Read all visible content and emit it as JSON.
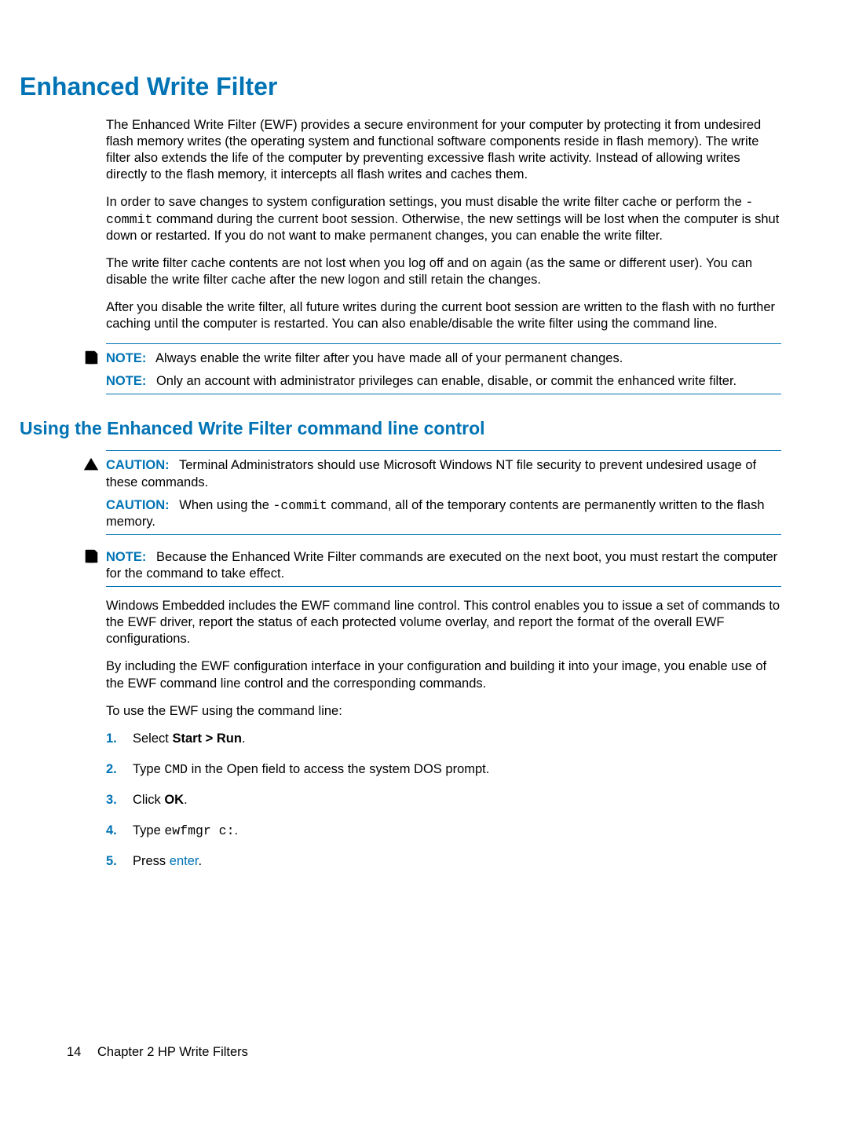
{
  "h1": "Enhanced Write Filter",
  "p1a": "The Enhanced Write Filter (EWF) provides a secure environment for your computer by protecting it from undesired flash memory writes (the operating system and functional software components reside in flash memory). The write filter also extends the life of the computer by preventing excessive flash write activity. Instead of allowing writes directly to the flash memory, it intercepts all flash writes and caches them.",
  "p2_pre": "In order to save changes to system configuration settings, you must disable the write filter cache or perform the ",
  "code_commit": "-commit",
  "p2_post": " command during the current boot session. Otherwise, the new settings will be lost when the computer is shut down or restarted. If you do not want to make permanent changes, you can enable the write filter.",
  "p3": "The write filter cache contents are not lost when you log off and on again (as the same or different user). You can disable the write filter cache after the new logon and still retain the changes.",
  "p4": "After you disable the write filter, all future writes during the current boot session are written to the flash with no further caching until the computer is restarted. You can also enable/disable the write filter using the command line.",
  "note_label": "NOTE:",
  "caution_label": "CAUTION:",
  "note1": "Always enable the write filter after you have made all of your permanent changes.",
  "note2": "Only an account with administrator privileges can enable, disable, or commit the enhanced write filter.",
  "h2": "Using the Enhanced Write Filter command line control",
  "caution1": "Terminal Administrators should use Microsoft Windows NT file security to prevent undesired usage of these commands.",
  "caution2_pre": "When using the ",
  "caution2_post": " command, all of the temporary contents are permanently written to the flash memory.",
  "note3": "Because the Enhanced Write Filter commands are executed on the next boot, you must restart the computer for the command to take effect.",
  "p5": "Windows Embedded includes the EWF command line control. This control enables you to issue a set of commands to the EWF driver, report the status of each protected volume overlay, and report the format of the overall EWF configurations.",
  "p6": "By including the EWF configuration interface in your configuration and building it into your image, you enable use of the EWF command line control and the corresponding commands.",
  "p7": "To use the EWF using the command line:",
  "steps": {
    "n1": "1.",
    "s1_pre": "Select ",
    "s1_b": "Start > Run",
    "s1_post": ".",
    "n2": "2.",
    "s2_pre": "Type ",
    "s2_code": "CMD",
    "s2_post": " in the Open field to access the system DOS prompt.",
    "n3": "3.",
    "s3_pre": "Click ",
    "s3_b": "OK",
    "s3_post": ".",
    "n4": "4.",
    "s4_pre": "Type ",
    "s4_code": "ewfmgr c:",
    "s4_post": ".",
    "n5": "5.",
    "s5_pre": "Press ",
    "s5_link": "enter",
    "s5_post": "."
  },
  "footer_page": "14",
  "footer_text": "Chapter 2   HP Write Filters"
}
